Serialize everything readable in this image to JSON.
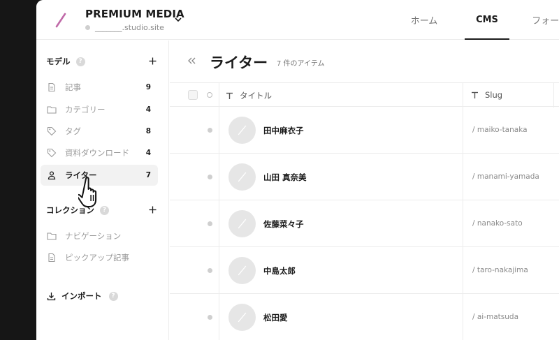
{
  "header": {
    "site_title": "PREMIUM MEDIA",
    "site_url": "_______.studio.site",
    "tabs": [
      {
        "label": "ホーム",
        "active": false
      },
      {
        "label": "CMS",
        "active": true
      },
      {
        "label": "フォーム",
        "active": false
      }
    ],
    "logo_color": "#c06aa8"
  },
  "sidebar": {
    "models_label": "モデル",
    "help_glyph": "?",
    "models": [
      {
        "label": "記事",
        "count": "9",
        "icon": "document-icon",
        "active": false
      },
      {
        "label": "カテゴリー",
        "count": "4",
        "icon": "folder-icon",
        "active": false
      },
      {
        "label": "タグ",
        "count": "8",
        "icon": "tag-icon",
        "active": false
      },
      {
        "label": "資料ダウンロード",
        "count": "4",
        "icon": "tag-icon",
        "active": false
      },
      {
        "label": "ライター",
        "count": "7",
        "icon": "person-icon",
        "active": true
      }
    ],
    "collections_label": "コレクション",
    "collections": [
      {
        "label": "ナビゲーション",
        "icon": "folder-icon"
      },
      {
        "label": "ピックアップ記事",
        "icon": "document-icon"
      }
    ],
    "import_label": "インポート"
  },
  "main": {
    "title": "ライター",
    "count_text": "7 件のアイテム",
    "columns": {
      "title": "タイトル",
      "slug": "Slug"
    },
    "rows": [
      {
        "name": "田中麻衣子",
        "slug": "/ maiko-tanaka"
      },
      {
        "name": "山田 真奈美",
        "slug": "/ manami-yamada"
      },
      {
        "name": "佐藤菜々子",
        "slug": "/ nanako-sato"
      },
      {
        "name": "中島太郎",
        "slug": "/ taro-nakajima"
      },
      {
        "name": "松田愛",
        "slug": "/ ai-matsuda"
      }
    ]
  }
}
